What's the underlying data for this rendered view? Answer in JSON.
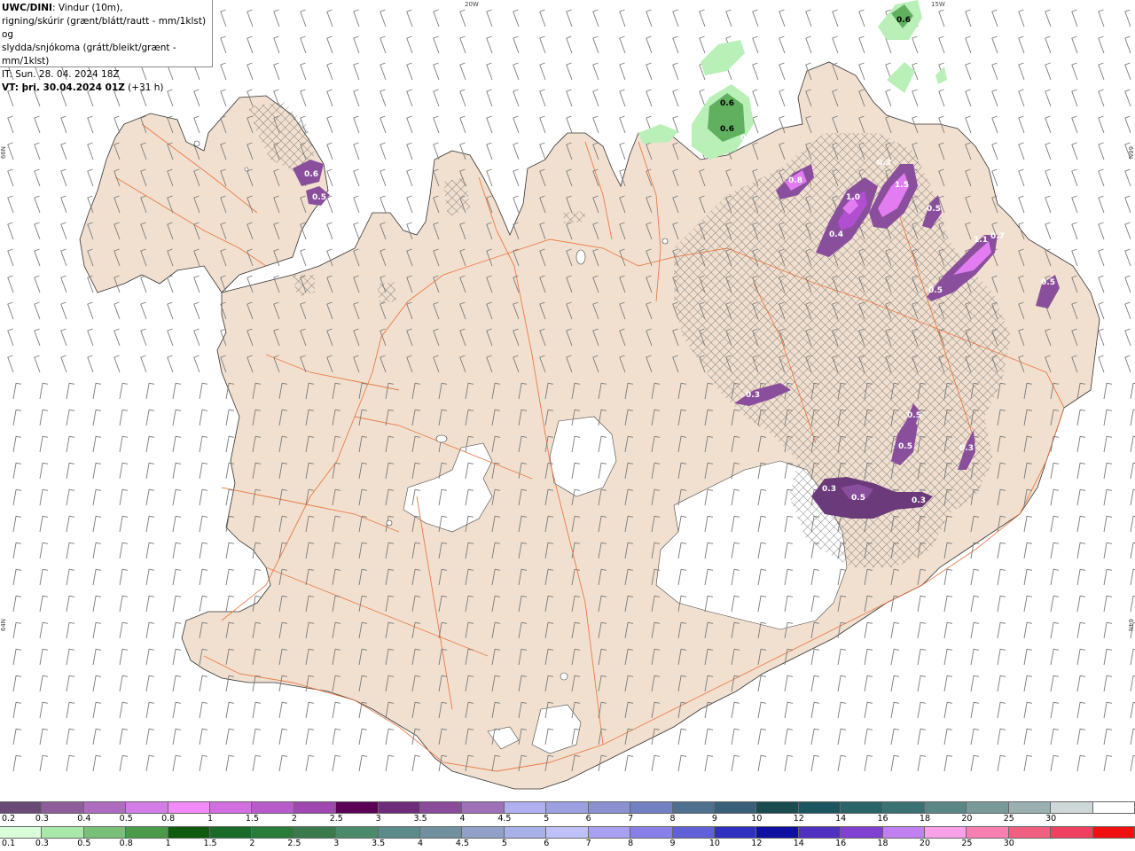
{
  "header": {
    "model": "UWC/DINI",
    "line1": ": Vindur (10m),",
    "line2": "rigning/skúrir (grænt/blátt/rautt - mm/1klst) og",
    "line3": "slydda/snjókoma (grátt/bleikt/grænt - mm/1klst)",
    "it_line": "IT: Sun. 28. 04. 2024 18Z",
    "vt_prefix": "VT: þri. 30.04.2024 01Z",
    "vt_suffix": " (+31 h)"
  },
  "grid_labels": {
    "top_20w": "20W",
    "top_15w": "15W",
    "left_66n": "66N",
    "right_66n": "66N",
    "left_64n": "64N",
    "right_64n": "64N"
  },
  "map_labels": [
    "0.6",
    "0.6",
    "0.6",
    "0.4",
    "0.6",
    "0.5",
    "0.8",
    "0.3",
    "1.0",
    "1.5",
    "0.5",
    "0.4",
    "1.1",
    "0.7",
    "0.5",
    "0.5",
    "0.3",
    "0.5",
    "0.5",
    "0.3",
    "0.5",
    "0.3",
    "0.3"
  ],
  "legend_snow": {
    "colors": [
      "#6b4b76",
      "#8e5e9a",
      "#ae6cc0",
      "#d27de6",
      "#f28af8",
      "#d36ee0",
      "#b85bca",
      "#9e48b0",
      "#5a0055",
      "#6e2d7a",
      "#8a4c9a",
      "#9d70b8",
      "#b0b0f0",
      "#9da0e0",
      "#8a90d0",
      "#7080c0",
      "#507090",
      "#3a5f78",
      "#1a4b50",
      "#1b5660",
      "#286468",
      "#3a7274",
      "#5a8686",
      "#7a9a9a",
      "#9aafb0",
      "#cfd8d8",
      "#ffffff"
    ],
    "labels": [
      "0.2",
      "0.3",
      "0.4",
      "0.5",
      "0.8",
      "1",
      "1.5",
      "2",
      "2.5",
      "3",
      "3.5",
      "4",
      "4.5",
      "5",
      "6",
      "7",
      "8",
      "9",
      "10",
      "12",
      "14",
      "16",
      "18",
      "20",
      "25",
      "30"
    ]
  },
  "legend_rain": {
    "colors": [
      "#d8ffd8",
      "#a8e8a8",
      "#78c078",
      "#4a9a4a",
      "#0e5a0e",
      "#1a6a2a",
      "#2a7a3a",
      "#3a7a4a",
      "#4a8a6a",
      "#5a8a8a",
      "#7090a0",
      "#90a0c8",
      "#a8b0e8",
      "#c0c0f8",
      "#a8a0f0",
      "#8880e8",
      "#6060d8",
      "#3030c0",
      "#1010a0",
      "#5030c0",
      "#8040d0",
      "#c080f0",
      "#f8a0e8",
      "#f880b0",
      "#f06080",
      "#f04060",
      "#f01010"
    ],
    "labels": [
      "0.1",
      "0.3",
      "0.5",
      "0.8",
      "1",
      "1.5",
      "2",
      "2.5",
      "3",
      "3.5",
      "4",
      "4.5",
      "5",
      "6",
      "7",
      "8",
      "9",
      "10",
      "12",
      "14",
      "16",
      "18",
      "20",
      "25",
      "30"
    ]
  },
  "colors": {
    "land": "#f1e0cf",
    "glacier": "#ffffff",
    "roads": "#e8703a",
    "wind_barb": "#7a7a7a",
    "snow_light": "#8a4f9c",
    "snow_mid": "#b04fd0",
    "snow_heavy": "#e27cf0",
    "rain_light": "#b8f0b8",
    "rain_mid": "#60b060"
  }
}
